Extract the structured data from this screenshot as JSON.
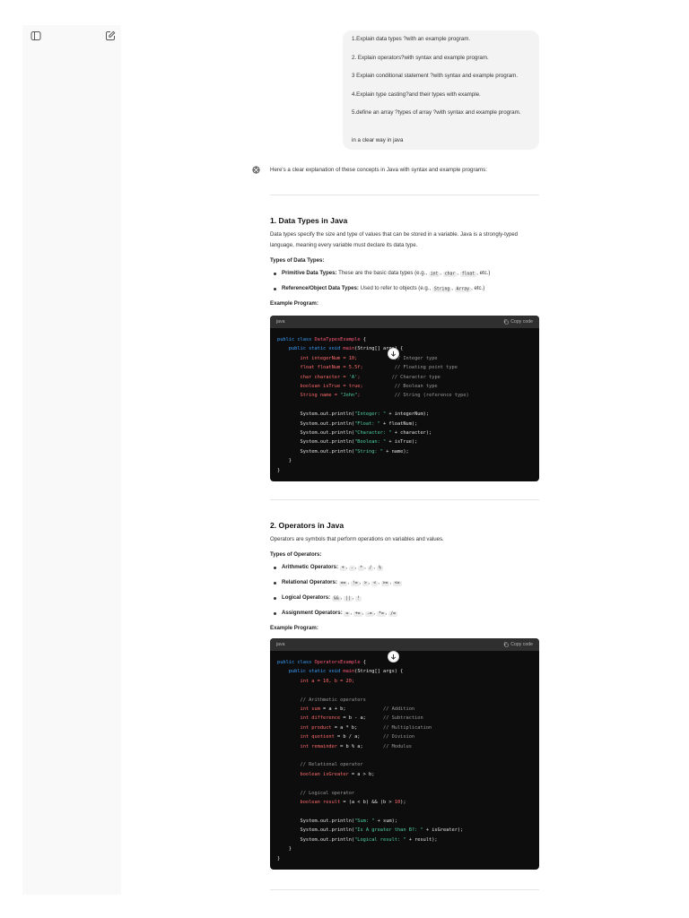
{
  "user_message": {
    "lines": [
      "1.Explain data types ?with an example program.",
      "2. Explain operators?with syntax and example program.",
      "3 Explain conditional statement ?with syntax and example program.",
      "4.Explain type casting?and their types with example.",
      "5.define an array ?types of array ?with syntax and example program.",
      "in a clear way in java"
    ]
  },
  "assistant": {
    "intro": "Here's a clear explanation of these concepts in Java with syntax and example programs:"
  },
  "section1": {
    "title": "1. Data Types in Java",
    "desc": "Data types specify the size and type of values that can be stored in a variable. Java is a strongly-typed language, meaning every variable must declare its data type.",
    "types_heading": "Types of Data Types:",
    "bullet1": {
      "bold": "Primitive Data Types:",
      "text": " These are the basic data types (e.g., ",
      "c1": "int",
      "c2": "char",
      "c3": "float",
      "end": ", etc.)"
    },
    "bullet2": {
      "bold": "Reference/Object Data Types:",
      "text": " Used to refer to objects (e.g., ",
      "c1": "String",
      "c2": "Array",
      "end": ", etc.)"
    },
    "example_heading": "Example Program:",
    "code_lang": "java",
    "copy_label": "Copy code"
  },
  "section2": {
    "title": "2. Operators in Java",
    "desc": "Operators are symbols that perform operations on variables and values.",
    "types_heading": "Types of Operators:",
    "arith": {
      "bold": "Arithmetic Operators:",
      "ops": [
        "+",
        "-",
        "*",
        "/",
        "%"
      ]
    },
    "rel": {
      "bold": "Relational Operators:",
      "ops": [
        "==",
        "!=",
        ">",
        "<",
        ">=",
        "<="
      ]
    },
    "logic": {
      "bold": "Logical Operators:",
      "ops": [
        "&&",
        "||",
        "!"
      ]
    },
    "assign": {
      "bold": "Assignment Operators:",
      "ops": [
        "=",
        "+=",
        "-=",
        "*=",
        "/="
      ]
    },
    "example_heading": "Example Program:",
    "code_lang": "java",
    "copy_label": "Copy code"
  },
  "icons": {
    "sidebar_toggle": "sidebar-toggle-icon",
    "new_chat": "new-chat-icon",
    "assistant": "assistant-logo-icon",
    "copy": "copy-icon",
    "scroll_down": "arrow-down-icon"
  },
  "colors": {
    "code_bg": "#0d0d0d",
    "code_header": "#2f2f2f",
    "keyword": "#3aa0ff",
    "type": "#ff6b6b",
    "string": "#4fd1a5",
    "comment": "#9a9a9a"
  }
}
